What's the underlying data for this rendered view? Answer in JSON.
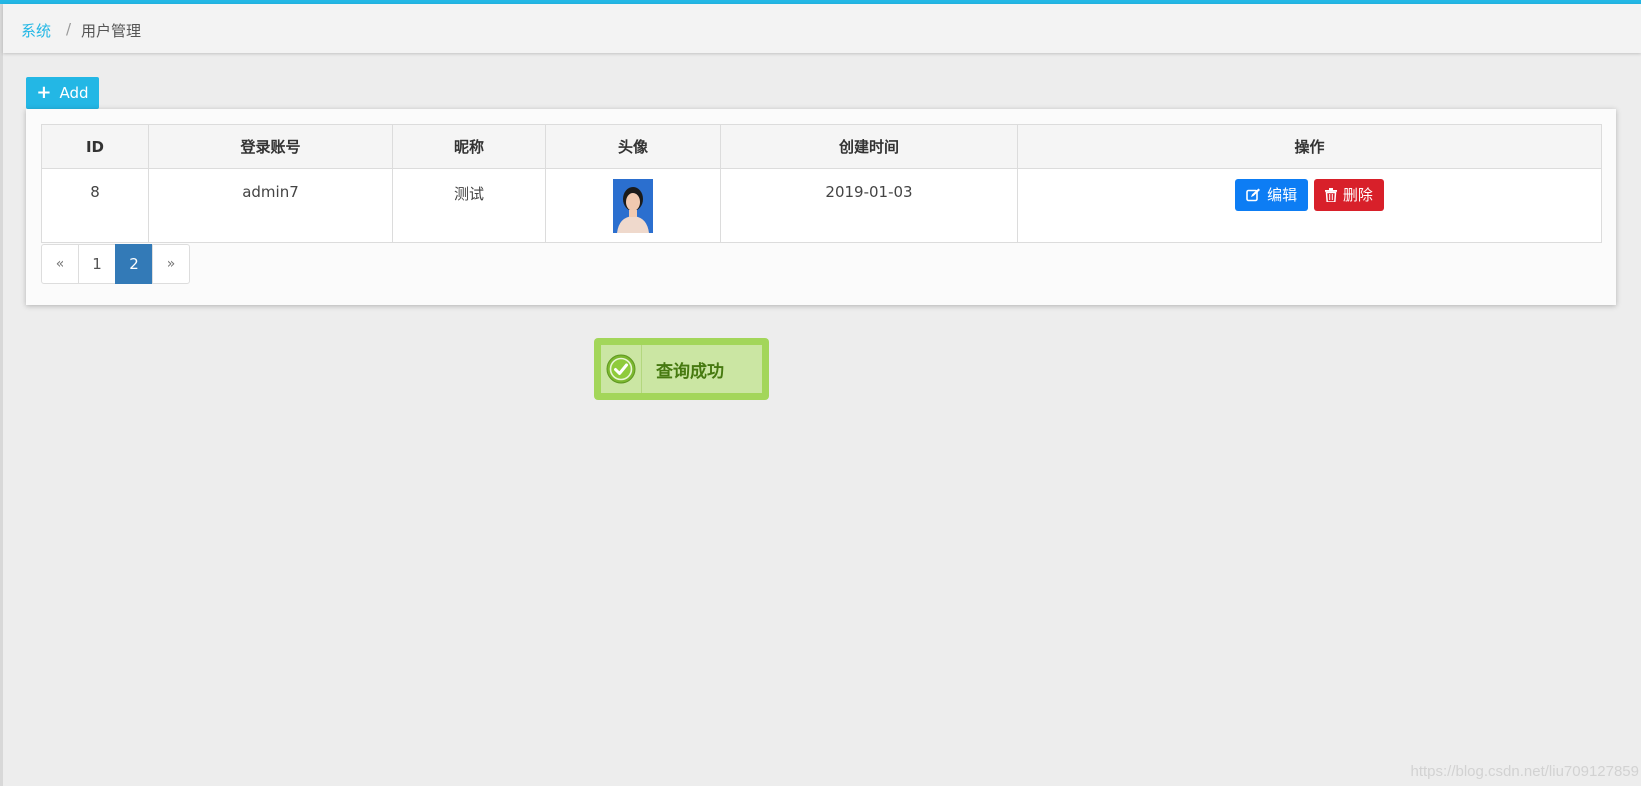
{
  "breadcrumb": {
    "root": "系统",
    "separator": "/",
    "current": "用户管理"
  },
  "toolbar": {
    "add_label": "Add",
    "add_icon": "plus-icon"
  },
  "table": {
    "headers": [
      "ID",
      "登录账号",
      "昵称",
      "头像",
      "创建时间",
      "操作"
    ],
    "rows": [
      {
        "id": "8",
        "account": "admin7",
        "nickname": "测试",
        "avatar": "user-photo",
        "created": "2019-01-03",
        "edit_label": "编辑",
        "delete_label": "删除"
      }
    ]
  },
  "pagination": {
    "prev": "«",
    "pages": [
      "1",
      "2"
    ],
    "active": "2",
    "next": "»"
  },
  "toast": {
    "message": "查询成功",
    "icon": "check-circle-icon"
  },
  "watermark": "https://blog.csdn.net/liu709127859",
  "colors": {
    "accent": "#23b7e5",
    "edit": "#0d7df4",
    "delete": "#d8202a",
    "active_page": "#337ab7",
    "toast_bg": "#cbe6a3"
  }
}
